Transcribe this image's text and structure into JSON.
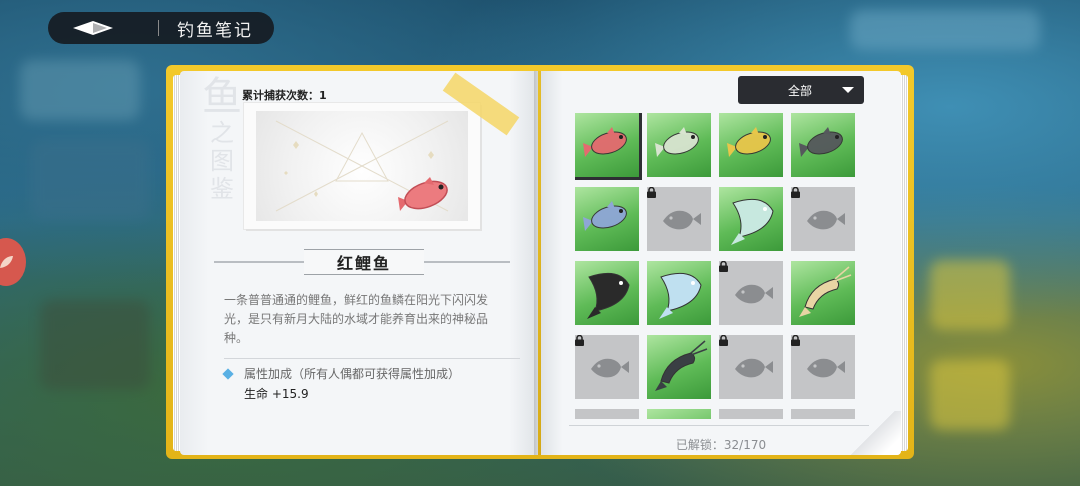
{
  "header": {
    "title": "钓鱼笔记",
    "back_icon": "diamond-back-icon"
  },
  "detail": {
    "watermark": [
      "鱼",
      "之",
      "图",
      "鉴"
    ],
    "catch_count": "累计捕获次数：1",
    "fish_name": "红鲤鱼",
    "description": "一条普普通通的鲤鱼，鲜红的鱼鳞在阳光下闪闪发光，是只有新月大陆的水域才能养育出来的神秘品种。",
    "attribute_header": "属性加成（所有人偶都可获得属性加成）",
    "attribute_value": "生命 +15.9"
  },
  "collection": {
    "filter_label": "全部",
    "unlock_status": "已解锁：32/170",
    "cells": [
      {
        "kind": "fish",
        "color": "#e46a6f",
        "locked": false,
        "selected": true
      },
      {
        "kind": "fish",
        "color": "#d8e4d0",
        "locked": false,
        "selected": false
      },
      {
        "kind": "fish",
        "color": "#e8c64a",
        "locked": false,
        "selected": false
      },
      {
        "kind": "fish",
        "color": "#55585c",
        "locked": false,
        "selected": false
      },
      {
        "kind": "fish",
        "color": "#8ea6d6",
        "locked": false,
        "selected": false
      },
      {
        "kind": "locked",
        "locked": true
      },
      {
        "kind": "ray",
        "color": "#c7e8df",
        "locked": false,
        "selected": false
      },
      {
        "kind": "locked",
        "locked": true
      },
      {
        "kind": "ray",
        "color": "#2a2a2a",
        "locked": false,
        "selected": false
      },
      {
        "kind": "ray",
        "color": "#bfe0f0",
        "locked": false,
        "selected": false
      },
      {
        "kind": "locked",
        "locked": true
      },
      {
        "kind": "shrimp",
        "color": "#e8d5a4",
        "locked": false,
        "selected": false
      },
      {
        "kind": "locked",
        "locked": true
      },
      {
        "kind": "shrimp",
        "color": "#3a3f44",
        "locked": false,
        "selected": false
      },
      {
        "kind": "locked",
        "locked": true
      },
      {
        "kind": "locked",
        "locked": true
      }
    ]
  }
}
